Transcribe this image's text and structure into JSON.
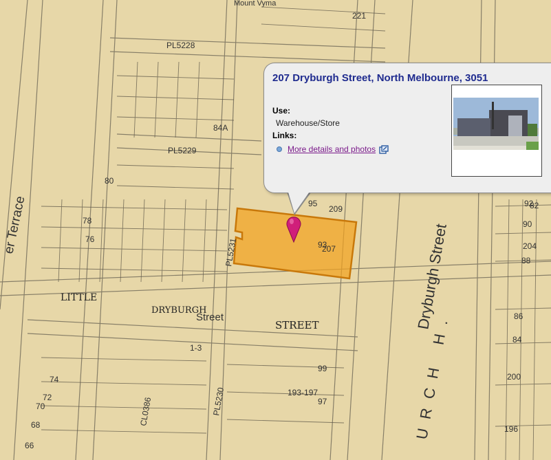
{
  "map": {
    "street_labels": {
      "dryburgh_vertical": "Dryburgh Street",
      "church": "URCH H.",
      "terrace": "er Terrace",
      "little": "LITTLE",
      "dryburgh_old": "DRYBURGH",
      "street_old": "Street",
      "street_caps": "STREET",
      "mount_vyma": "Mount Vyma"
    },
    "plan_labels": [
      "PL5228",
      "PL5229",
      "PL5231",
      "PL5230",
      "CL0386"
    ],
    "numbers": [
      "221",
      "209",
      "207",
      "204",
      "200",
      "196",
      "193-197",
      "84A",
      "82",
      "80",
      "78",
      "76",
      "74",
      "72",
      "70",
      "68",
      "66",
      "92",
      "90",
      "88",
      "86",
      "84",
      "93",
      "95",
      "99",
      "97",
      "1-3"
    ],
    "parcel_color": "#f2a21f",
    "parcel_border": "#c8780a",
    "marker_color": "#d01f7a"
  },
  "popup": {
    "title": "207 Dryburgh Street, North Melbourne, 3051",
    "use_label": "Use:",
    "use_value": "Warehouse/Store",
    "links_label": "Links:",
    "link_text": "More details and photos"
  }
}
